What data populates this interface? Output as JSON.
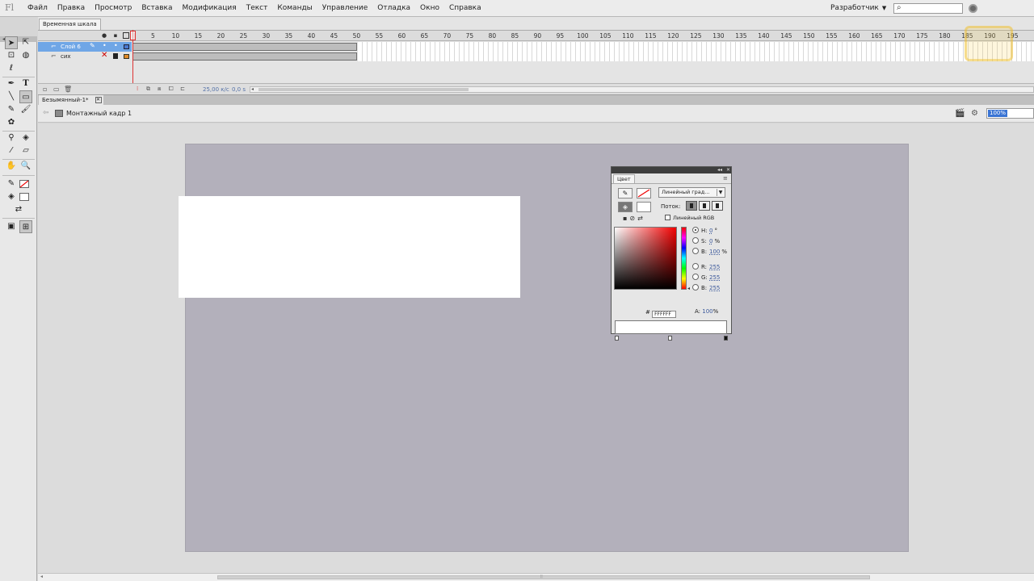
{
  "app": {
    "logo": "Fl"
  },
  "menu": [
    "Файл",
    "Правка",
    "Просмотр",
    "Вставка",
    "Модификация",
    "Текст",
    "Команды",
    "Управление",
    "Отладка",
    "Окно",
    "Справка"
  ],
  "workspace": "Разработчик",
  "search": {
    "placeholder": ""
  },
  "timeline": {
    "tab_label": "Временная шкала",
    "ruler": [
      "5",
      "10",
      "15",
      "20",
      "25",
      "30",
      "35",
      "40",
      "45",
      "50",
      "55",
      "60",
      "65",
      "70",
      "75",
      "80",
      "85",
      "90",
      "95",
      "100",
      "105",
      "110",
      "115",
      "120",
      "125",
      "130",
      "135",
      "140",
      "145",
      "150",
      "155",
      "160",
      "165",
      "170",
      "175",
      "180",
      "185",
      "190",
      "195"
    ],
    "layers": [
      {
        "name": "Слой 6",
        "selected": true
      },
      {
        "name": "сих",
        "selected": false
      }
    ],
    "fps": "25,00 к/с",
    "time": "0,0 s"
  },
  "document": {
    "tab_label": "Безымянный-1*",
    "scene_label": "Монтажный кадр 1",
    "zoom": "100%"
  },
  "color_panel": {
    "tab_label": "Цвет",
    "fill_type": "Линейный град...",
    "flow_label": "Поток:",
    "linear_rgb_label": "Линейный RGB",
    "fields": [
      {
        "label": "H:",
        "value": "0",
        "unit": "°",
        "checked": true
      },
      {
        "label": "S:",
        "value": "0",
        "unit": "%",
        "checked": false
      },
      {
        "label": "B:",
        "value": "100",
        "unit": "%",
        "checked": false
      },
      {
        "label": "R:",
        "value": "255",
        "unit": "",
        "checked": false
      },
      {
        "label": "G:",
        "value": "255",
        "unit": "",
        "checked": false
      },
      {
        "label": "B:",
        "value": "255",
        "unit": "",
        "checked": false
      }
    ],
    "alpha_label": "A:",
    "alpha_value": "100",
    "alpha_unit": "%",
    "hex_prefix": "#",
    "hex": "FFFFFF"
  },
  "colors": {
    "stage": "#b3b0bb",
    "pasteboard": "#dcdcdc",
    "layer_selected": "#6fa6e6",
    "rect_fill": "#ffffff"
  }
}
